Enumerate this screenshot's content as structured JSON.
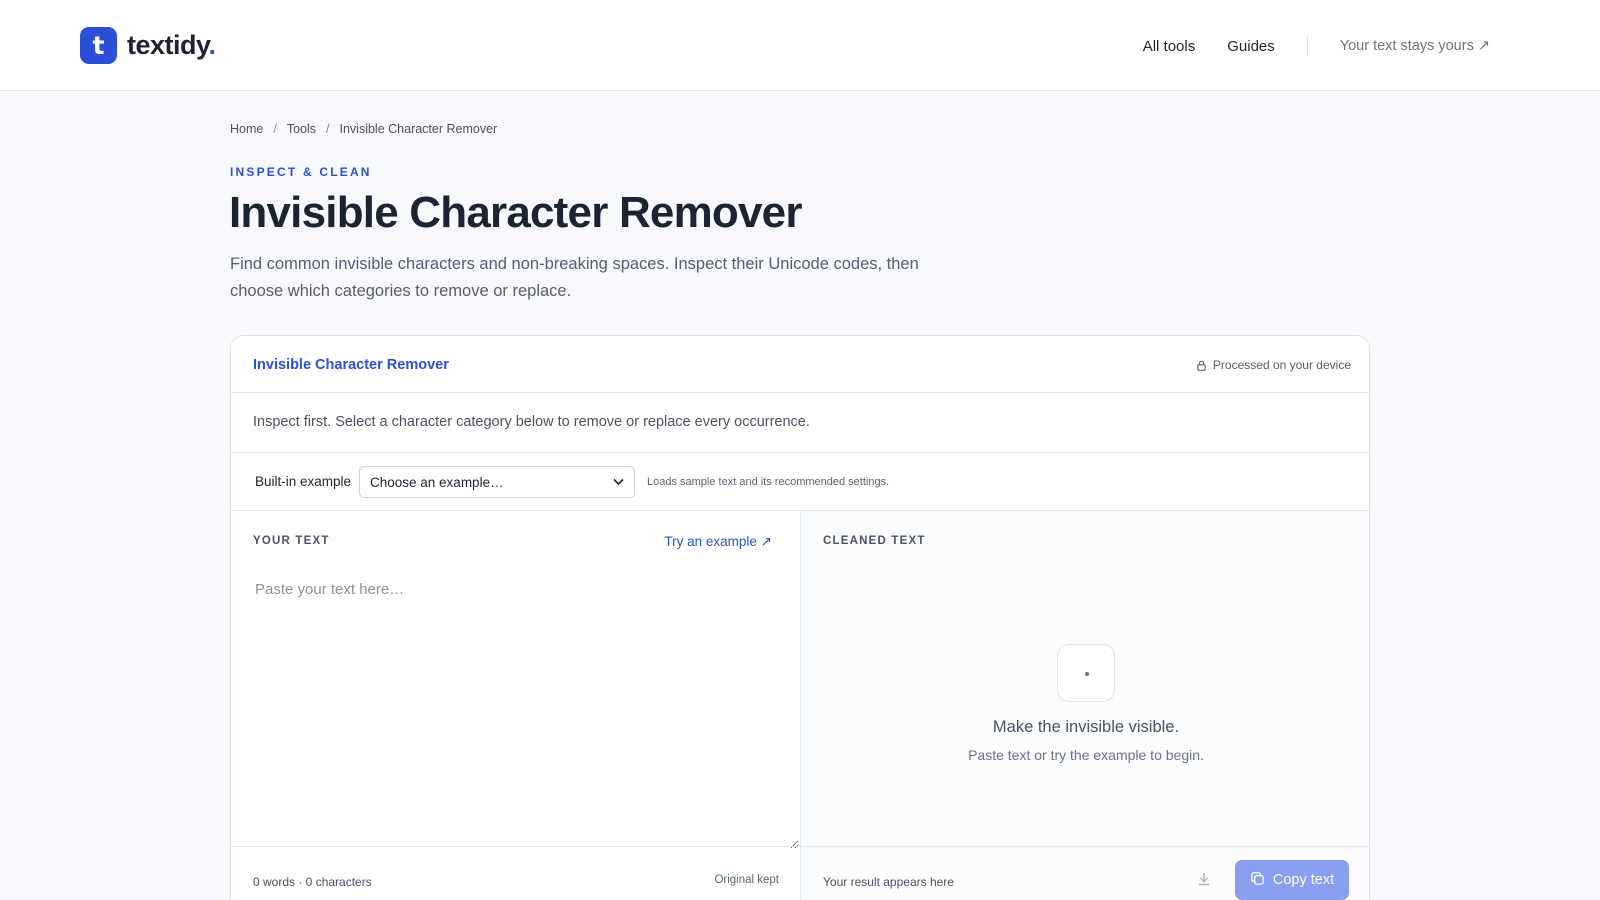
{
  "header": {
    "logo_mark": "t",
    "logo_name": "textidy",
    "logo_dot": ".",
    "nav": {
      "all_tools": "All tools",
      "guides": "Guides",
      "privacy": "Your text stays yours ↗"
    }
  },
  "breadcrumb": {
    "items": [
      "Home",
      "Tools",
      "Invisible Character Remover"
    ],
    "separator": "/"
  },
  "hero": {
    "eyebrow": "INSPECT & CLEAN",
    "title": "Invisible Character Remover",
    "lede": "Find common invisible characters and non-breaking spaces. Inspect their Unicode codes, then choose which categories to remove or replace."
  },
  "tool": {
    "title": "Invisible Character Remover",
    "device_note": "Processed on your device",
    "hint": "Inspect first. Select a character category below to remove or replace every occurrence.",
    "example": {
      "label": "Built-in example",
      "selected": "Choose an example…",
      "note": "Loads sample text and its recommended settings."
    },
    "input": {
      "label": "YOUR TEXT",
      "try_link": "Try an example ↗",
      "placeholder": "Paste your text here…",
      "value": ""
    },
    "output": {
      "label": "CLEANED TEXT",
      "empty_title": "Make the invisible visible.",
      "empty_sub": "Paste text or try the example to begin."
    },
    "footer": {
      "counts": "0 words · 0 characters",
      "original_state": "Original kept",
      "result_hint": "Your result appears here",
      "copy_label": "Copy text"
    }
  },
  "colors": {
    "accent": "#2c4fd8",
    "copy_button_disabled": "#8a9ff0",
    "text": "#1c2434",
    "muted": "#555d6e"
  },
  "icons": {
    "lock": "lock-icon",
    "download": "download-icon",
    "copy": "copy-icon"
  }
}
